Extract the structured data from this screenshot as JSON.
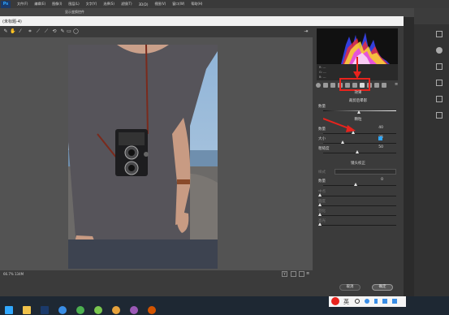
{
  "app": {
    "logo": "Ps",
    "menu": [
      "文件(F)",
      "编辑(E)",
      "图像(I)",
      "图层(L)",
      "文字(Y)",
      "选择(S)",
      "滤镜(T)",
      "3D(D)",
      "视图(V)",
      "窗口(W)",
      "帮助(H)"
    ],
    "options_title": "显示变换控件"
  },
  "dialog": {
    "title": "(未标题-4)",
    "panel_section_effects": "效果",
    "section_post_crop_vignette": "裁剪后晕影",
    "section_grain": "颗粒",
    "section_camera": "镜头校正",
    "grain_amount_label": "数量",
    "grain_amount_value": "40",
    "grain_size_label": "大小",
    "grain_size_value": "25",
    "grain_roughness_label": "粗糙度",
    "grain_roughness_value": "50",
    "vignette_amount_label": "数量",
    "vignette_amount_value": "0",
    "style_label": "样式",
    "amount2_label": "数量",
    "amount2_value": "0",
    "midpoint_label": "中点",
    "roundness_label": "圆度",
    "feather_label": "羽化",
    "highlights_label": "高光",
    "cancel_label": "取消",
    "ok_label": "确定",
    "zoom_label": "Y",
    "hist_r": "R: ---",
    "hist_g": "G: ---",
    "hist_b": "B: ---",
    "status_left": "66.7% 134M"
  },
  "ime": {
    "label": "英"
  },
  "colors": {
    "highlight": "#e8231d",
    "accent": "#31a8ff"
  }
}
